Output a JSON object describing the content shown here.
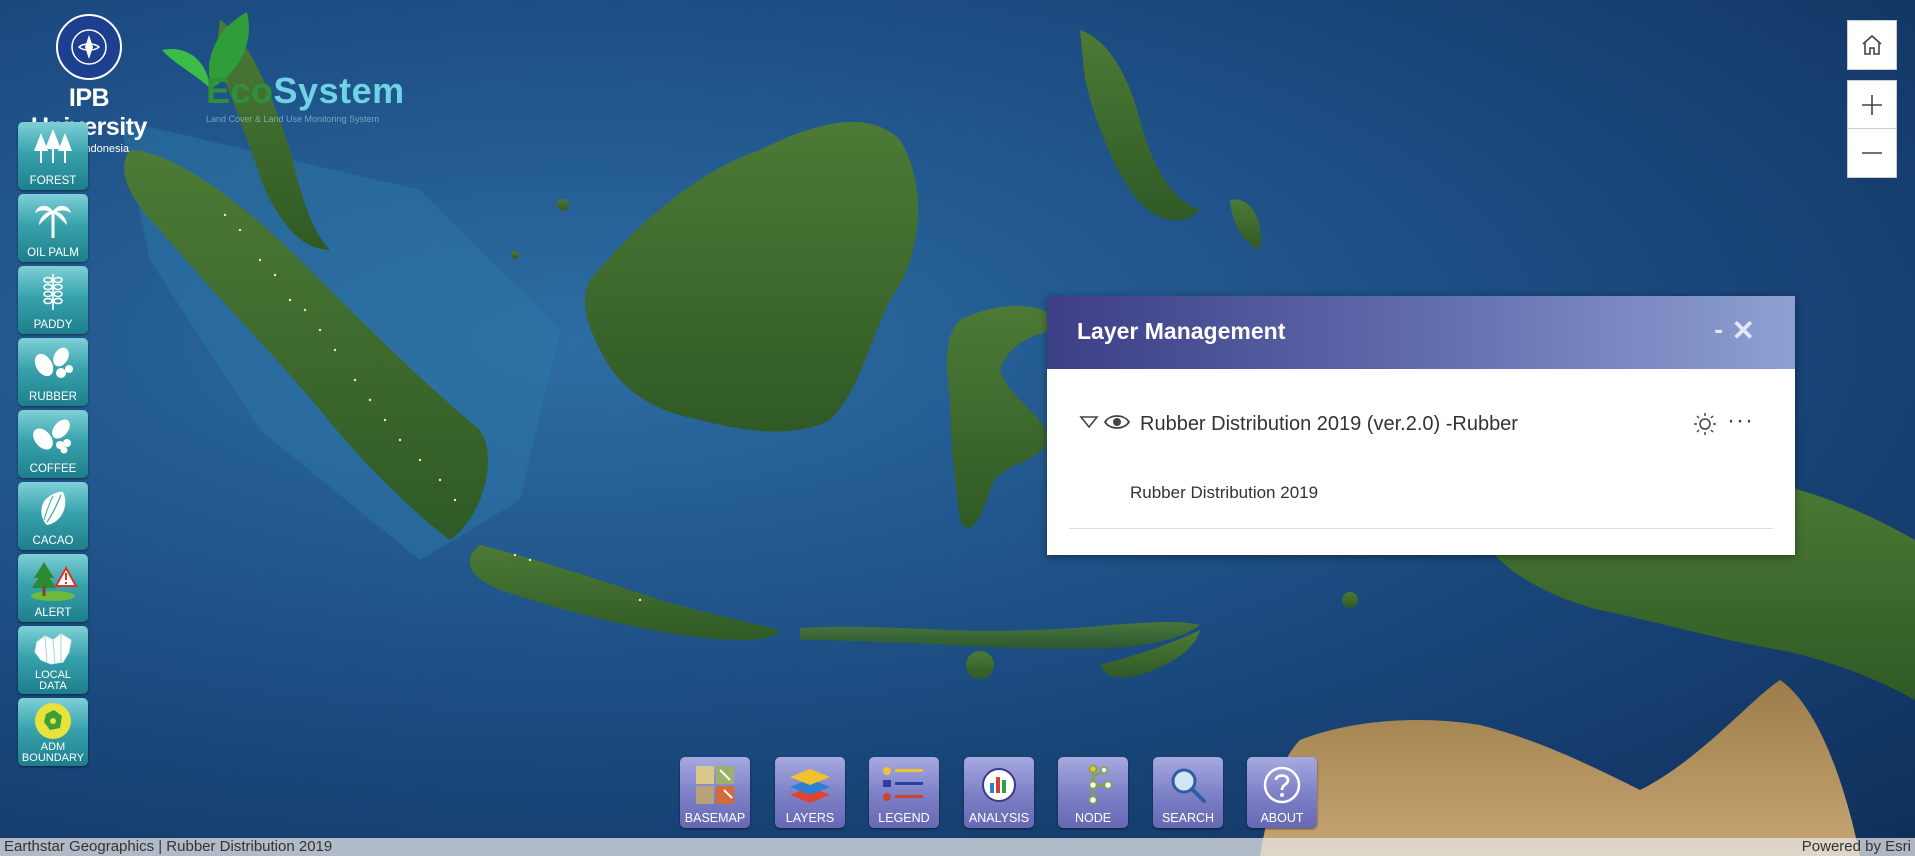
{
  "logos": {
    "ipb": {
      "name": "IPB University",
      "sub": "Bogor Indonesia"
    },
    "ecosystem": {
      "word_part1": "Eco",
      "word_part2": "System",
      "tagline": "Land Cover & Land Use Monitoring System"
    }
  },
  "sidebar": {
    "items": [
      {
        "label": "FOREST",
        "icon": "forest-icon"
      },
      {
        "label": "OIL PALM",
        "icon": "palm-tree-icon"
      },
      {
        "label": "PADDY",
        "icon": "rice-icon"
      },
      {
        "label": "RUBBER",
        "icon": "rubber-leaf-icon"
      },
      {
        "label": "COFFEE",
        "icon": "coffee-branch-icon"
      },
      {
        "label": "CACAO",
        "icon": "cacao-pod-icon"
      },
      {
        "label": "ALERT",
        "icon": "alert-tree-icon"
      },
      {
        "label_line1": "LOCAL",
        "label_line2": "DATA",
        "icon": "map-data-icon"
      },
      {
        "label_line1": "ADM",
        "label_line2": "BOUNDARY",
        "icon": "boundary-icon"
      }
    ]
  },
  "map_controls": {
    "home": "home-icon",
    "zoom_in": "plus-icon",
    "zoom_out": "minus-icon"
  },
  "panel": {
    "title": "Layer Management",
    "minimize": "-",
    "close": "✕",
    "layer": {
      "title": "Rubber Distribution 2019 (ver.2.0) -Rubber",
      "more": "···"
    },
    "sublayer": "Rubber Distribution 2019"
  },
  "bottom_toolbar": {
    "items": [
      {
        "label": "BASEMAP",
        "icon": "basemap-icon"
      },
      {
        "label": "LAYERS",
        "icon": "layers-icon"
      },
      {
        "label": "LEGEND",
        "icon": "legend-icon"
      },
      {
        "label": "ANALYSIS",
        "icon": "analysis-icon"
      },
      {
        "label": "NODE",
        "icon": "node-icon"
      },
      {
        "label": "SEARCH",
        "icon": "search-icon"
      },
      {
        "label": "ABOUT",
        "icon": "help-icon"
      }
    ]
  },
  "attribution": {
    "left": "Earthstar Geographics | Rubber Distribution 2019",
    "right": "Powered by Esri"
  },
  "colors": {
    "ocean": "#1d4f85",
    "land": "#3d6b2e",
    "sidebar_btn": "#38a3ad",
    "toolbar_btn": "#7f82c8",
    "panel_head": "#4f58a0"
  }
}
